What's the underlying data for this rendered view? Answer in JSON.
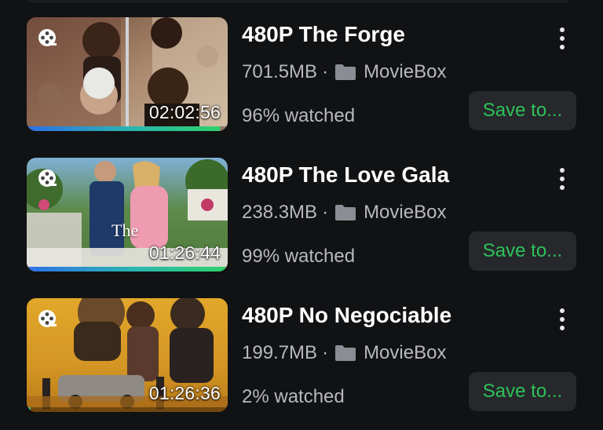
{
  "items": [
    {
      "title": "480P The Forge",
      "size": "701.5MB",
      "separator": "·",
      "folder": "MovieBox",
      "duration": "02:02:56",
      "watched_label": "96% watched",
      "progress": 0.96,
      "save_label": "Save to...",
      "thumb_icon": "film-reel-icon",
      "more_icon": "more-vertical-icon",
      "folder_icon": "folder-icon"
    },
    {
      "title": "480P The Love Gala",
      "size": "238.3MB",
      "separator": "·",
      "folder": "MovieBox",
      "duration": "01:26:44",
      "watched_label": "99% watched",
      "progress": 0.99,
      "thumb_text": "The",
      "save_label": "Save to...",
      "thumb_icon": "film-reel-icon",
      "more_icon": "more-vertical-icon",
      "folder_icon": "folder-icon"
    },
    {
      "title": "480P No Negociable",
      "size": "199.7MB",
      "separator": "·",
      "folder": "MovieBox",
      "duration": "01:26:36",
      "watched_label": "2% watched",
      "progress": 0.02,
      "save_label": "Save to...",
      "thumb_icon": "film-reel-icon",
      "more_icon": "more-vertical-icon",
      "folder_icon": "folder-icon"
    }
  ],
  "colors": {
    "background": "#111214",
    "accent_green": "#2ec25a",
    "progress_start": "#2f6fe8",
    "progress_end": "#2fd06a",
    "button_bg": "#26282b",
    "secondary_text": "#b8b9bd"
  }
}
